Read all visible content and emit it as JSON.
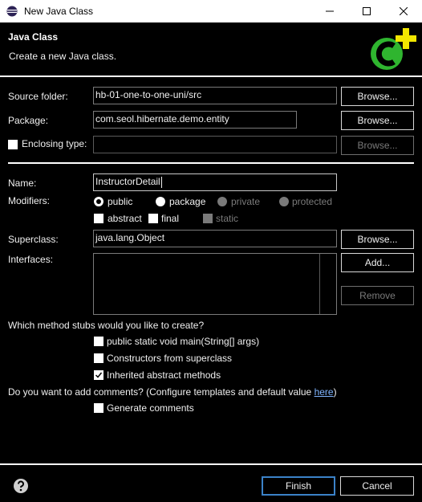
{
  "window": {
    "title": "New Java Class"
  },
  "header": {
    "title": "Java Class",
    "subtitle": "Create a new Java class."
  },
  "icons": {
    "app": "eclipse-icon",
    "wizard_banner": "new-class-icon",
    "help": "help-icon"
  },
  "form": {
    "source_folder": {
      "label": "Source folder:",
      "value": "hb-01-one-to-one-uni/src",
      "button": "Browse..."
    },
    "package": {
      "label": "Package:",
      "value": "com.seol.hibernate.demo.entity",
      "button": "Browse..."
    },
    "enclosing_type": {
      "label": "Enclosing type:",
      "checked": false,
      "value": "",
      "button": "Browse..."
    },
    "name": {
      "label": "Name:",
      "value": "InstructorDetail"
    },
    "modifiers": {
      "label": "Modifiers:",
      "access": [
        {
          "label": "public",
          "selected": true,
          "enabled": true
        },
        {
          "label": "package",
          "selected": false,
          "enabled": true
        },
        {
          "label": "private",
          "selected": false,
          "enabled": false
        },
        {
          "label": "protected",
          "selected": false,
          "enabled": false
        }
      ],
      "flags": [
        {
          "label": "abstract",
          "checked": false,
          "enabled": true
        },
        {
          "label": "final",
          "checked": false,
          "enabled": true
        },
        {
          "label": "static",
          "checked": false,
          "enabled": false
        }
      ]
    },
    "superclass": {
      "label": "Superclass:",
      "value": "java.lang.Object",
      "button": "Browse..."
    },
    "interfaces": {
      "label": "Interfaces:",
      "add_button": "Add...",
      "remove_button": "Remove"
    },
    "stubs": {
      "question": "Which method stubs would you like to create?",
      "options": [
        {
          "label": "public static void main(String[] args)",
          "checked": false
        },
        {
          "label": "Constructors from superclass",
          "checked": false
        },
        {
          "label": "Inherited abstract methods",
          "checked": true
        }
      ]
    },
    "comments": {
      "question": "Do you want to add comments? (Configure templates and default value ",
      "link": "here",
      "question_end": ")",
      "option": {
        "label": "Generate comments",
        "checked": false
      }
    }
  },
  "footer": {
    "finish": "Finish",
    "cancel": "Cancel"
  }
}
